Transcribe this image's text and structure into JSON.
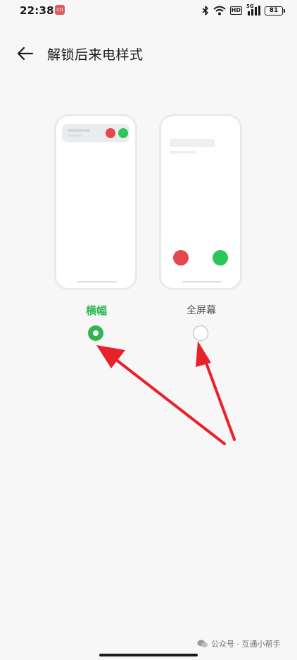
{
  "status_bar": {
    "time": "22:38",
    "app_icon_label": "cn",
    "hd_label": "HD",
    "network_label": "5G",
    "battery_level": "81",
    "icons": [
      "notification-app-icon",
      "bluetooth-icon",
      "wifi-icon",
      "hd-icon",
      "signal-icon",
      "battery-icon"
    ]
  },
  "header": {
    "back_icon": "back-arrow-icon",
    "title": "解锁后来电样式"
  },
  "options": [
    {
      "label": "横幅",
      "selected": true
    },
    {
      "label": "全屏幕",
      "selected": false
    }
  ],
  "colors": {
    "accent_green": "#33b450",
    "decline_red": "#e5474f",
    "accept_green": "#2cc65a",
    "annotation_red": "#e8222a",
    "background": "#f7f7f7"
  },
  "watermark": {
    "icon": "wechat-icon",
    "text": "公众号 · 互通小帮手"
  }
}
